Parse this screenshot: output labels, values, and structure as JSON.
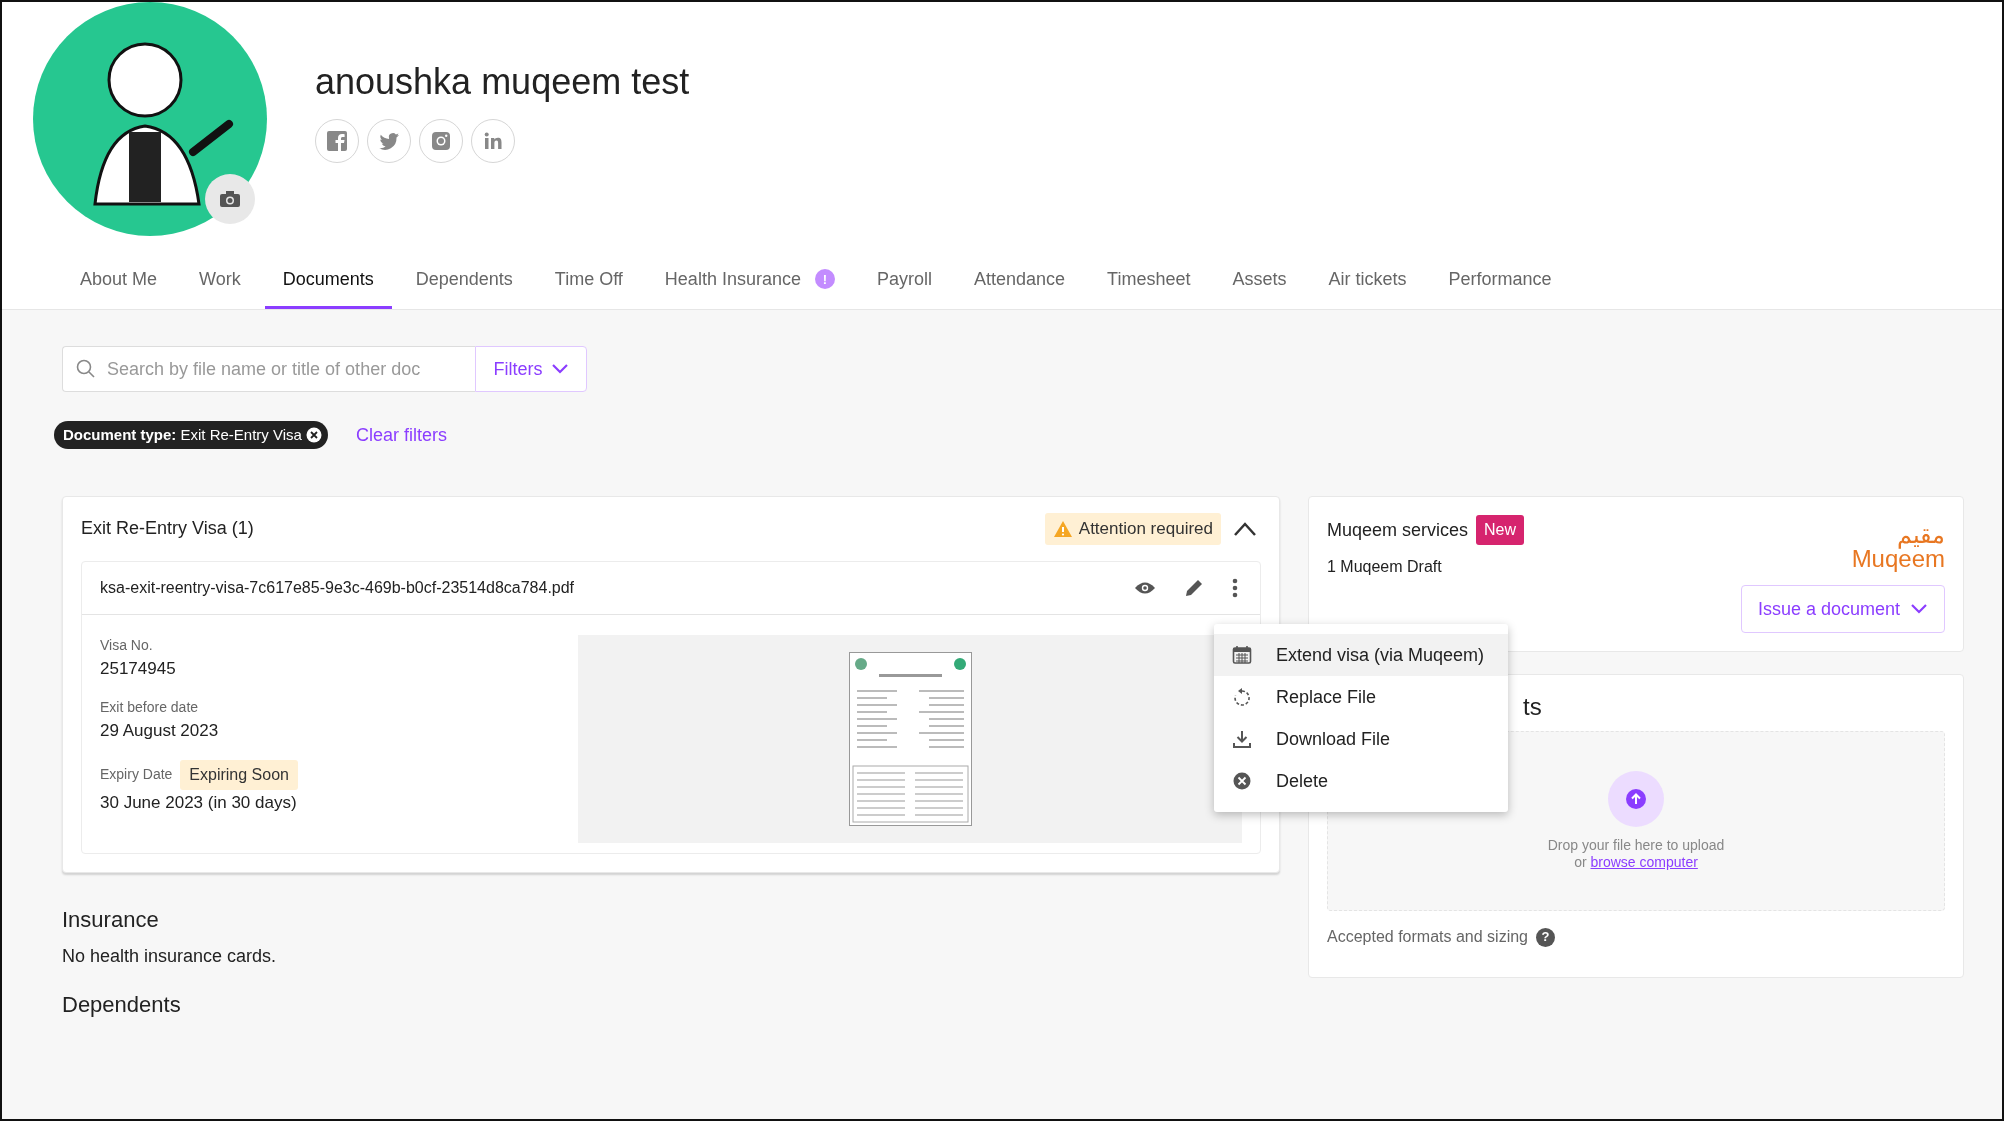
{
  "profile": {
    "name": "anoushka muqeem test"
  },
  "tabs": [
    {
      "label": "About Me",
      "selected": false
    },
    {
      "label": "Work",
      "selected": false
    },
    {
      "label": "Documents",
      "selected": true
    },
    {
      "label": "Dependents",
      "selected": false
    },
    {
      "label": "Time Off",
      "selected": false
    },
    {
      "label": "Health Insurance",
      "selected": false,
      "badge": "!"
    },
    {
      "label": "Payroll",
      "selected": false
    },
    {
      "label": "Attendance",
      "selected": false
    },
    {
      "label": "Timesheet",
      "selected": false
    },
    {
      "label": "Assets",
      "selected": false
    },
    {
      "label": "Air tickets",
      "selected": false
    },
    {
      "label": "Performance",
      "selected": false
    }
  ],
  "search": {
    "placeholder": "Search by file name or title of other doc"
  },
  "filters_button": "Filters",
  "active_filters": [
    "**Document type:** Exit Re-Entry Visa"
  ],
  "clear_filters": "Clear filters",
  "document_group": {
    "title": "Exit Re-Entry Visa (1)",
    "status": "Attention required",
    "expanded": true,
    "files": [
      {
        "filename": "ksa-exit-reentry-visa-7c617e85-9e3c-469b-b0cf-23514d8ca784.pdf",
        "fields": [
          {
            "label": "Visa No.",
            "value": "25174945"
          },
          {
            "label": "Exit before date",
            "value": "29 August 2023"
          },
          {
            "label": "Expiry Date",
            "tag": "Expiring Soon",
            "value": "30 June 2023 (in 30 days)"
          }
        ]
      }
    ]
  },
  "file_menu": [
    {
      "kind": "extend",
      "label": "Extend visa (via Muqeem)",
      "highlighted": true
    },
    {
      "kind": "replace",
      "label": "Replace File",
      "highlighted": false
    },
    {
      "kind": "download",
      "label": "Download File",
      "highlighted": false
    },
    {
      "kind": "delete",
      "label": "Delete",
      "highlighted": false
    }
  ],
  "muqeem": {
    "title": "Muqeem services",
    "badge": "New",
    "subtitle": "1 Muqeem Draft",
    "logo": [
      "مقيم",
      "Muqeem"
    ],
    "issue_button": "Issue a document"
  },
  "upload": {
    "heading": "ts",
    "drop_text": "Drop your file here to upload",
    "or_text": "or",
    "link": "browse computer",
    "formats": "Accepted formats and sizing",
    "help": "?"
  },
  "sections": [
    {
      "title": "Insurance",
      "text": "No health insurance cards."
    },
    {
      "title": "Dependents"
    }
  ]
}
